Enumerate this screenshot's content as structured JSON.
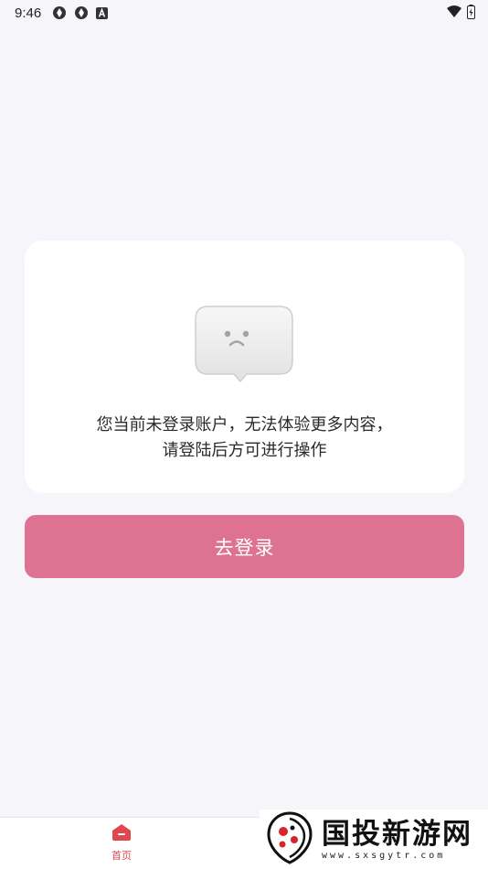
{
  "status_bar": {
    "time": "9:46",
    "icons": [
      "sync-icon",
      "sync-icon",
      "font-icon"
    ],
    "right_icons": [
      "wifi-icon",
      "battery-icon"
    ]
  },
  "empty_state": {
    "icon": "sad-face-bubble-icon",
    "message_line1": "您当前未登录账户，无法体验更多内容，",
    "message_line2": "请登陆后方可进行操作"
  },
  "login_button": {
    "label": "去登录",
    "color": "#dd7293"
  },
  "tab_bar": {
    "tabs": [
      {
        "label": "首页",
        "icon": "home-icon",
        "active": true,
        "color": "#e0474f"
      }
    ]
  },
  "watermark": {
    "title": "国投新游网",
    "url": "www.sxsgytr.com"
  }
}
